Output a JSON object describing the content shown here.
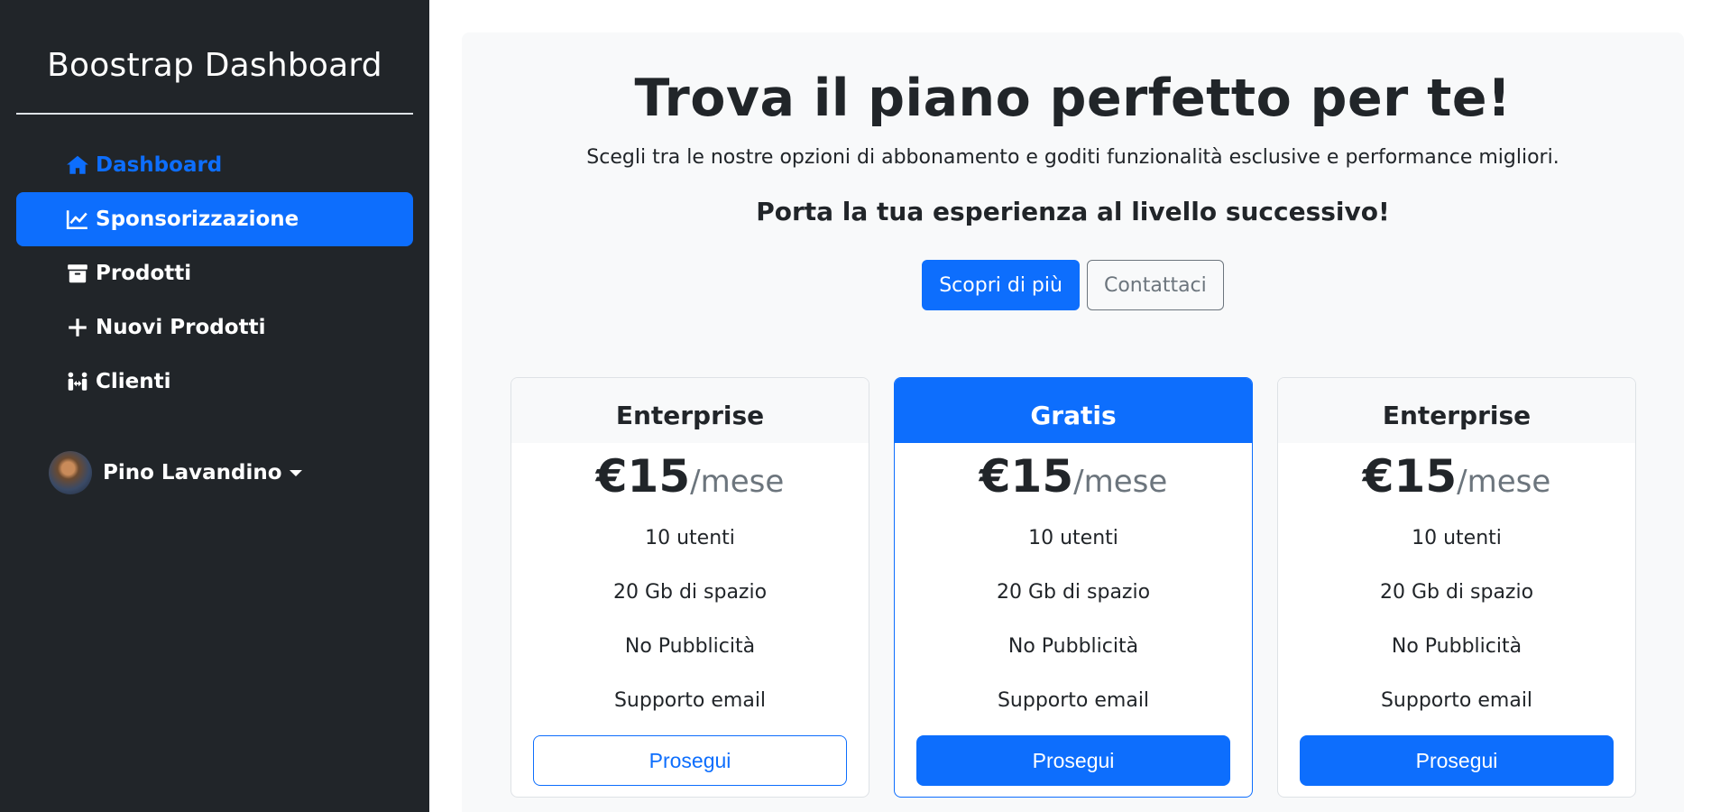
{
  "sidebar": {
    "brand": "Boostrap Dashboard",
    "items": [
      {
        "label": "Dashboard",
        "icon": "home-icon"
      },
      {
        "label": "Sponsorizzazione",
        "icon": "chart-line-icon"
      },
      {
        "label": "Prodotti",
        "icon": "archive-box-icon"
      },
      {
        "label": "Nuovi Prodotti",
        "icon": "plus-icon"
      },
      {
        "label": "Clienti",
        "icon": "people-arrows-icon"
      }
    ],
    "user": {
      "name": "Pino Lavandino"
    }
  },
  "hero": {
    "title": "Trova il piano perfetto per te!",
    "subtitle": "Scegli tra le nostre opzioni di abbonamento e goditi funzionalità esclusive e performance migliori.",
    "lead": "Porta la tua esperienza al livello successivo!",
    "primary_button": "Scopri di più",
    "secondary_button": "Contattaci"
  },
  "plans": [
    {
      "name": "Enterprise",
      "price": "€15",
      "period": "/mese",
      "features": [
        "10 utenti",
        "20 Gb di spazio",
        "No Pubblicità",
        "Supporto email"
      ],
      "button": "Prosegui"
    },
    {
      "name": "Gratis",
      "price": "€15",
      "period": "/mese",
      "features": [
        "10 utenti",
        "20 Gb di spazio",
        "No Pubblicità",
        "Supporto email"
      ],
      "button": "Prosegui"
    },
    {
      "name": "Enterprise",
      "price": "€15",
      "period": "/mese",
      "features": [
        "10 utenti",
        "20 Gb di spazio",
        "No Pubblicità",
        "Supporto email"
      ],
      "button": "Prosegui"
    }
  ],
  "colors": {
    "primary": "#0d6efd",
    "sidebar_bg": "#212529",
    "main_bg": "#f8f9fa",
    "secondary": "#6c757d"
  }
}
